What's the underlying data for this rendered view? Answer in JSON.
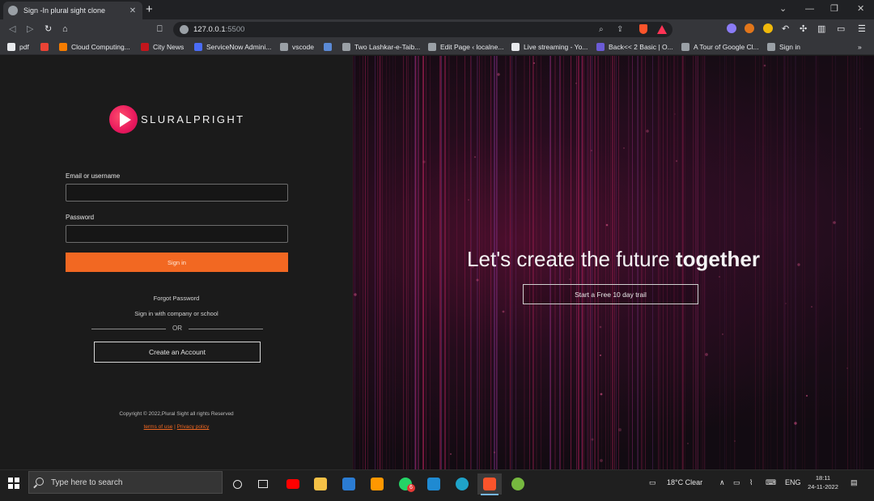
{
  "browser": {
    "tab": {
      "title": "Sign -In plural sight clone",
      "close": "✕"
    },
    "new_tab": "+",
    "window_controls": [
      "⌄",
      "—",
      "❐",
      "✕"
    ],
    "url": {
      "host": "127.0.0.1",
      "port": ":5500"
    },
    "bookmarks": [
      {
        "label": "pdf",
        "icon": "github-icon",
        "color": "#e8eaed"
      },
      {
        "label": "",
        "icon": "gmail-icon",
        "color": "#ea4335"
      },
      {
        "label": "Cloud Computing...",
        "icon": "cloud-icon",
        "color": "#f57c00"
      },
      {
        "label": "City News",
        "icon": "toi-icon",
        "color": "#c3161c"
      },
      {
        "label": "ServiceNow Admini...",
        "icon": "servicenow-icon",
        "color": "#4a6cf7"
      },
      {
        "label": "vscode",
        "icon": "globe-icon",
        "color": "#9aa0a6"
      },
      {
        "label": "",
        "icon": "bookmark-app-icon",
        "color": "#5b8ad6"
      },
      {
        "label": "Two Lashkar-e-Taib...",
        "icon": "globe-icon",
        "color": "#9aa0a6"
      },
      {
        "label": "Edit Page ‹ localne...",
        "icon": "globe-icon",
        "color": "#9aa0a6"
      },
      {
        "label": "Live streaming - Yo...",
        "icon": "google-icon",
        "color": "#e8eaed"
      },
      {
        "label": "Back<< 2 Basic | O...",
        "icon": "page-icon",
        "color": "#6b5bd6"
      },
      {
        "label": "A Tour of Google Cl...",
        "icon": "globe-icon",
        "color": "#9aa0a6"
      },
      {
        "label": "Sign in",
        "icon": "globe-icon",
        "color": "#9aa0a6"
      }
    ],
    "bookmarks_more": "»"
  },
  "login": {
    "logo_text": "SLURALPRIGHT",
    "email_label": "Email or username",
    "email_value": "",
    "password_label": "Password",
    "password_value": "",
    "signin_button": "Sign in",
    "forgot_password": "Forgot Password",
    "company_signin": "Sign in with company or school",
    "or": "OR",
    "create_account": "Create an Account",
    "copyright": "Copyright © 2022,Plural Sight all rights Reserved",
    "terms": "terms of use",
    "separator": " | ",
    "privacy": "Privacy policy"
  },
  "hero": {
    "tagline_light": "Let's create the future ",
    "tagline_bold": "together",
    "trial_button": "Start a Free 10 day trail"
  },
  "taskbar": {
    "search_placeholder": "Type here to search",
    "weather": "18°C  Clear",
    "language": "ENG",
    "time": "18:11",
    "date": "24-11-2022",
    "whatsapp_badge": "6"
  },
  "colors": {
    "accent": "#f26822",
    "logo": "#e8185d"
  }
}
